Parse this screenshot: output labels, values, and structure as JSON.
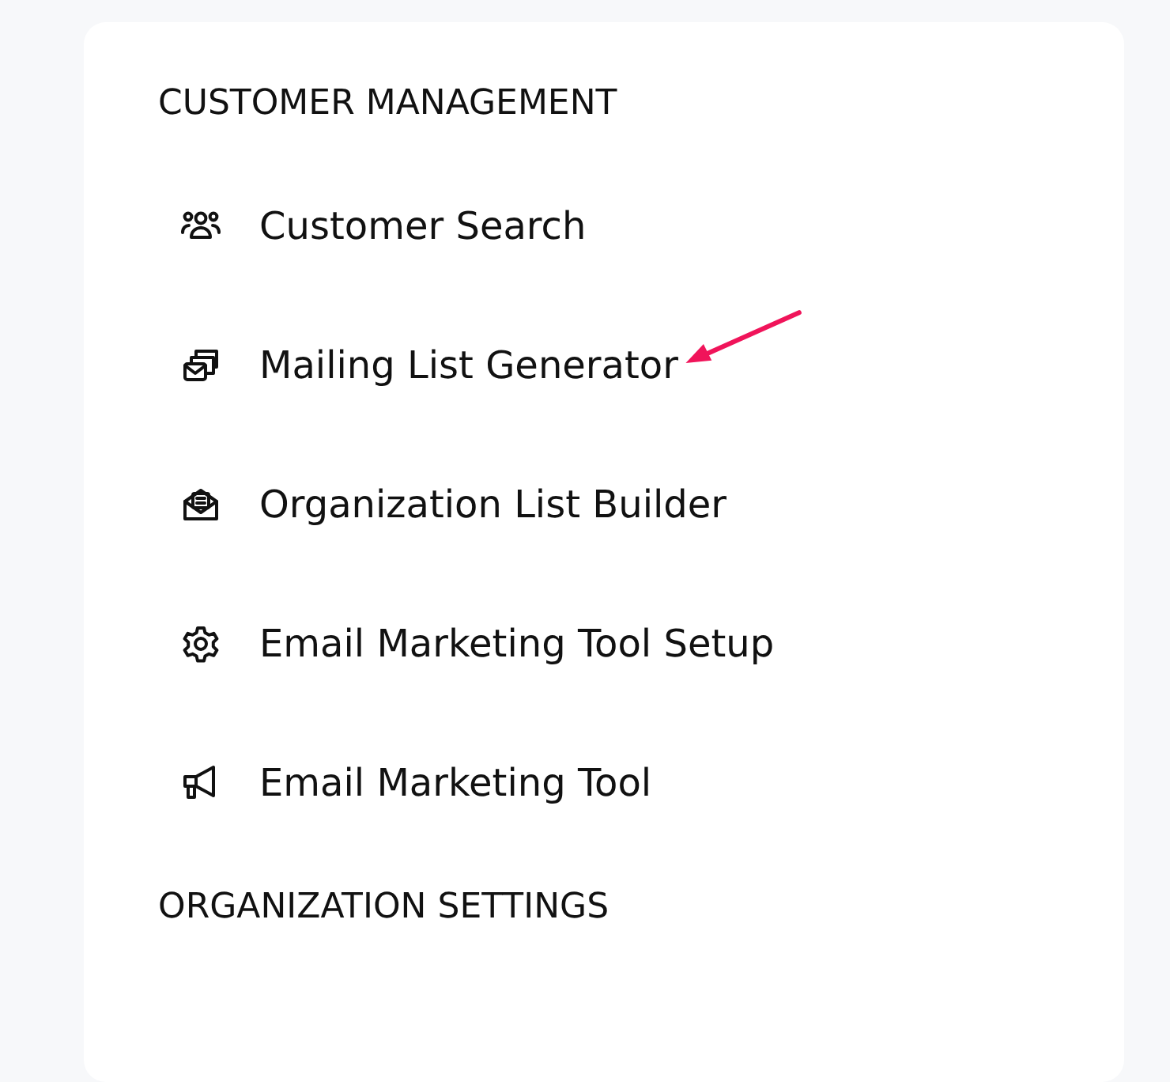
{
  "sections": [
    {
      "title": "CUSTOMER MANAGEMENT",
      "items": [
        {
          "label": "Customer Search",
          "annotated": false
        },
        {
          "label": "Mailing List Generator",
          "annotated": true
        },
        {
          "label": "Organization List Builder",
          "annotated": false
        },
        {
          "label": "Email Marketing Tool Setup",
          "annotated": false
        },
        {
          "label": "Email Marketing Tool",
          "annotated": false
        }
      ]
    },
    {
      "title": "ORGANIZATION SETTINGS"
    }
  ]
}
